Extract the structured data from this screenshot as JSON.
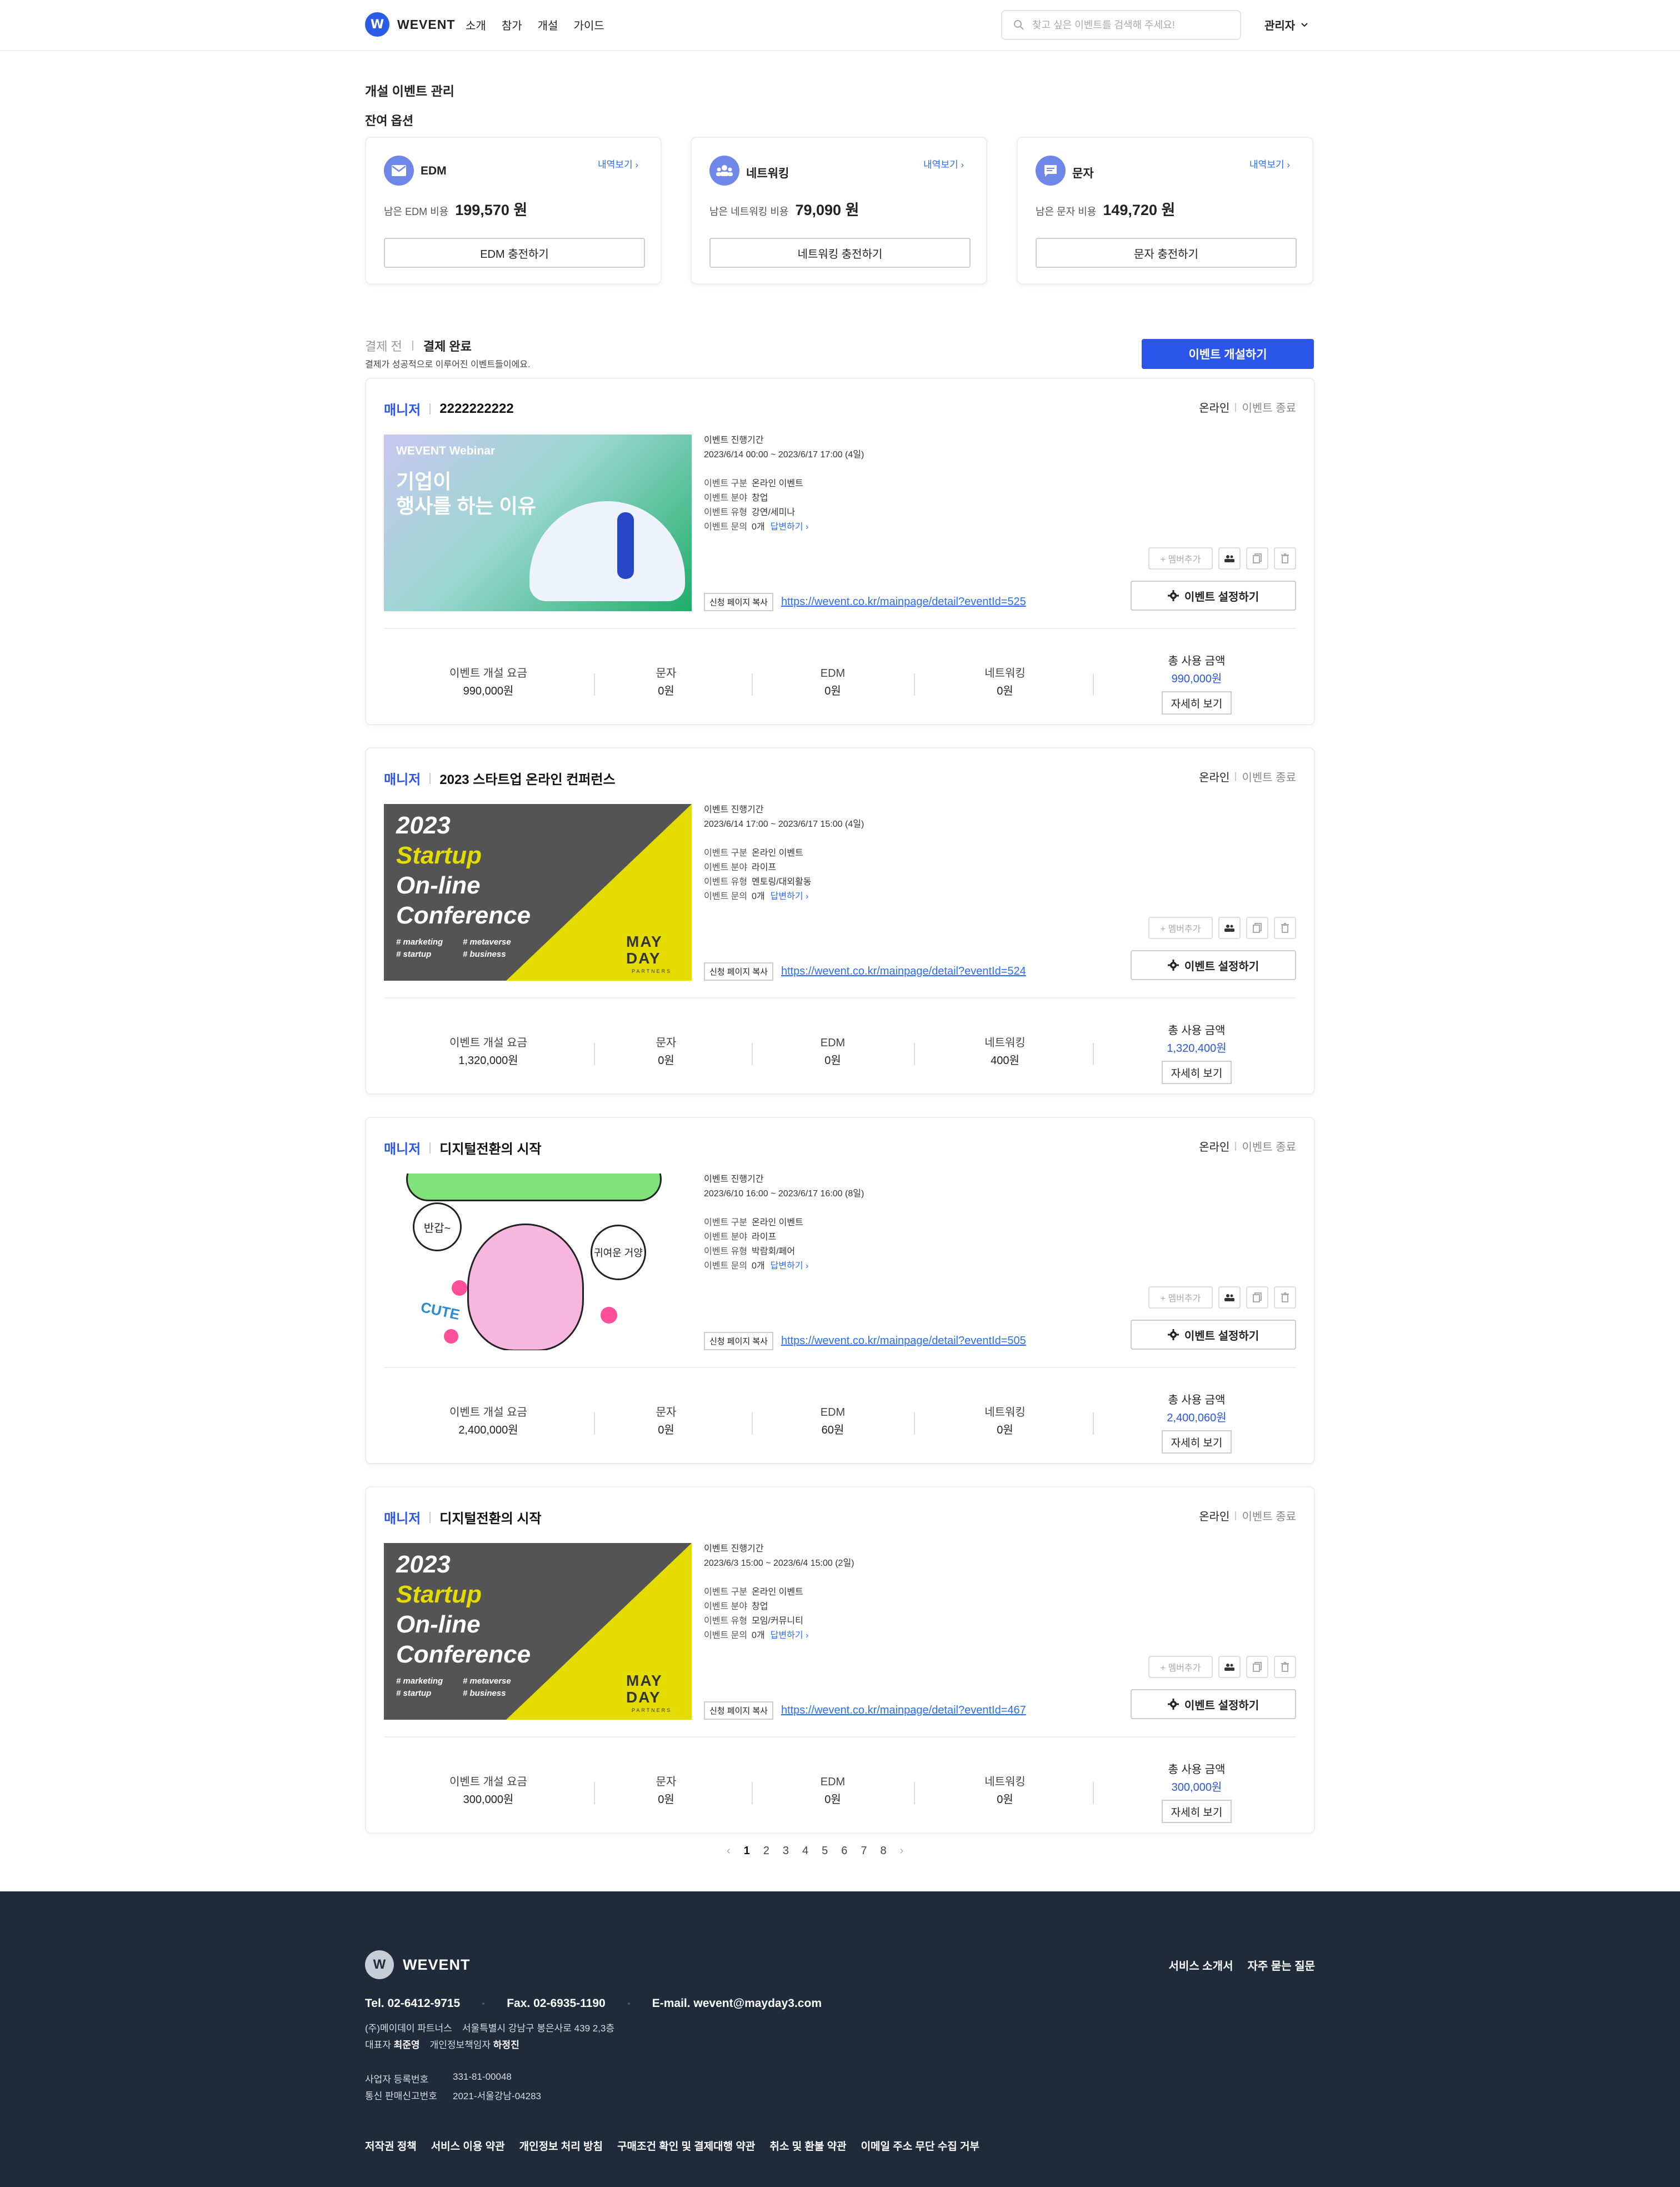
{
  "header": {
    "logo_mark": "W",
    "logo_text": "WEVENT",
    "nav": [
      "소개",
      "참가",
      "개설",
      "가이드"
    ],
    "search_placeholder": "찾고 싶은 이벤트를 검색해 주세요!",
    "admin_label": "관리자"
  },
  "page_title": "개설 이벤트 관리",
  "remaining_title": "잔여 옵션",
  "options": [
    {
      "name": "EDM",
      "history": "내역보기",
      "remain_label": "남은 EDM 비용",
      "amount": "199,570 원",
      "button": "EDM 충전하기",
      "icon": "mail-icon"
    },
    {
      "name": "네트워킹",
      "history": "내역보기",
      "remain_label": "남은 네트워킹 비용",
      "amount": "79,090 원",
      "button": "네트워킹 충전하기",
      "icon": "people-icon"
    },
    {
      "name": "문자",
      "history": "내역보기",
      "remain_label": "남은 문자 비용",
      "amount": "149,720 원",
      "button": "문자 충전하기",
      "icon": "message-icon"
    }
  ],
  "tabs": {
    "before": "결제 전",
    "done": "결제 완료",
    "desc": "결제가 성공적으로 이루어진 이벤트들이에요."
  },
  "create_button": "이벤트 개설하기",
  "labels": {
    "period": "이벤트 진행기간",
    "kind": "이벤트 구분",
    "field": "이벤트 분야",
    "type": "이벤트 유형",
    "inquiry": "이벤트 문의",
    "answer": "답변하기",
    "copy": "신청 페이지 복사",
    "member_add": "+ 멤버추가",
    "setting": "이벤트 설정하기",
    "fee": "이벤트 개설 요금",
    "sms": "문자",
    "edm": "EDM",
    "networking": "네트워킹",
    "total": "총 사용 금액",
    "detail": "자세히 보기"
  },
  "events": [
    {
      "role": "매니저",
      "title": "2222222222",
      "status": "온라인",
      "state": "이벤트 종료",
      "period": "2023/6/14 00:00 ~ 2023/6/17 17:00 (4일)",
      "kind": "온라인 이벤트",
      "field": "창업",
      "type": "강연/세미나",
      "inquiry": "0개",
      "link": "https://wevent.co.kr/mainpage/detail?eventId=525",
      "fee": "990,000원",
      "sms": "0원",
      "edm": "0원",
      "networking": "0원",
      "total": "990,000원",
      "thumb": {
        "kind": "webinar",
        "brand": "WEVENT Webinar",
        "line1": "기업이",
        "line2": "행사를 하는 이유"
      }
    },
    {
      "role": "매니저",
      "title": "2023 스타트업 온라인 컨퍼런스",
      "status": "온라인",
      "state": "이벤트 종료",
      "period": "2023/6/14 17:00 ~ 2023/6/17 15:00 (4일)",
      "kind": "온라인 이벤트",
      "field": "라이프",
      "type": "멘토링/대외활동",
      "inquiry": "0개",
      "link": "https://wevent.co.kr/mainpage/detail?eventId=524",
      "fee": "1,320,000원",
      "sms": "0원",
      "edm": "0원",
      "networking": "400원",
      "total": "1,320,400원",
      "thumb": {
        "kind": "conference",
        "year": "2023",
        "l1": "Startup",
        "l2": "On-line",
        "l3": "Conference",
        "t1": "# marketing",
        "t2": "# metaverse",
        "t3": "# startup",
        "t4": "# business",
        "mark1": "MAY",
        "mark2": "DAY",
        "mark3": "PARTNERS"
      }
    },
    {
      "role": "매니저",
      "title": "디지털전환의 시작",
      "status": "온라인",
      "state": "이벤트 종료",
      "period": "2023/6/10 16:00 ~ 2023/6/17 16:00 (8일)",
      "kind": "온라인 이벤트",
      "field": "라이프",
      "type": "박람회/페어",
      "inquiry": "0개",
      "link": "https://wevent.co.kr/mainpage/detail?eventId=505",
      "fee": "2,400,000원",
      "sms": "0원",
      "edm": "60원",
      "networking": "0원",
      "total": "2,400,060원",
      "thumb": {
        "kind": "bunny",
        "b1": "반갑~",
        "b2": "귀여운 거양",
        "cute": "CUTE"
      }
    },
    {
      "role": "매니저",
      "title": "디지털전환의 시작",
      "status": "온라인",
      "state": "이벤트 종료",
      "period": "2023/6/3 15:00 ~ 2023/6/4 15:00 (2일)",
      "kind": "온라인 이벤트",
      "field": "창업",
      "type": "모임/커뮤니티",
      "inquiry": "0개",
      "link": "https://wevent.co.kr/mainpage/detail?eventId=467",
      "fee": "300,000원",
      "sms": "0원",
      "edm": "0원",
      "networking": "0원",
      "total": "300,000원",
      "thumb": {
        "kind": "conference",
        "year": "2023",
        "l1": "Startup",
        "l2": "On-line",
        "l3": "Conference",
        "t1": "# marketing",
        "t2": "# metaverse",
        "t3": "# startup",
        "t4": "# business",
        "mark1": "MAY",
        "mark2": "DAY",
        "mark3": "PARTNERS"
      }
    }
  ],
  "pagination": {
    "prev": "‹",
    "pages": [
      "1",
      "2",
      "3",
      "4",
      "5",
      "6",
      "7",
      "8"
    ],
    "current": "1",
    "next": "›"
  },
  "footer": {
    "logo_mark": "W",
    "logo_text": "WEVENT",
    "top_links": [
      "서비스 소개서",
      "자주 묻는 질문"
    ],
    "tel": "Tel. 02-6412-9715",
    "fax": "Fax. 02-6935-1190",
    "email": "E-mail. wevent@mayday3.com",
    "company": "(주)메이데이 파트너스",
    "address": "서울특별시 강남구 봉은사로 439 2,3층",
    "ceo_label": "대표자",
    "ceo": "최준영",
    "privacy_label": "개인정보책임자",
    "privacy": "하정진",
    "biz_label": "사업자 등록번호",
    "biz": "331-81-00048",
    "sales_label": "통신 판매신고번호",
    "sales": "2021-서울강남-04283",
    "bottom_links": [
      "저작권 정책",
      "서비스 이용 약관",
      "개인정보 처리 방침",
      "구매조건 확인 및 결제대행 약관",
      "취소 및 환불 약관",
      "이메일 주소 무단 수집 거부"
    ]
  },
  "colors": {
    "accent": "#2b54e8",
    "link": "#2b6cff",
    "footer_bg": "#1f2a3a",
    "option_icon_bg": "#6f87e8"
  }
}
